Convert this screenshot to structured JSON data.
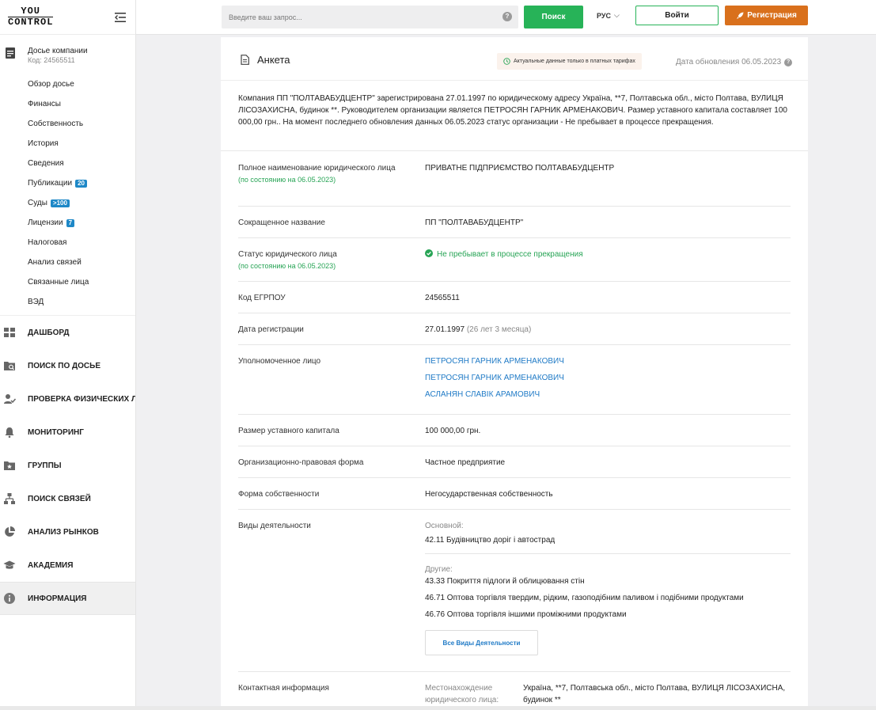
{
  "logo": {
    "line1": "YOU",
    "line2": "CONTROL"
  },
  "dossier": {
    "title": "Досье компании",
    "code": "Код: 24565511"
  },
  "sub_menu": [
    {
      "label": "Обзор досье"
    },
    {
      "label": "Финансы"
    },
    {
      "label": "Собственность"
    },
    {
      "label": "История"
    },
    {
      "label": "Сведения"
    },
    {
      "label": "Публикации",
      "badge": "20"
    },
    {
      "label": "Суды",
      "badge": ">100"
    },
    {
      "label": "Лицензии",
      "badge": "7"
    },
    {
      "label": "Налоговая"
    },
    {
      "label": "Анализ связей"
    },
    {
      "label": "Связанные лица"
    },
    {
      "label": "ВЭД"
    }
  ],
  "main_menu": [
    {
      "label": "ДАШБОРД",
      "icon": "dashboard-icon"
    },
    {
      "label": "ПОИСК ПО ДОСЬЕ",
      "icon": "folder-search-icon"
    },
    {
      "label": "ПРОВЕРКА ФИЗИЧЕСКИХ Л...",
      "icon": "person-check-icon"
    },
    {
      "label": "МОНИТОРИНГ",
      "icon": "bell-icon"
    },
    {
      "label": "ГРУППЫ",
      "icon": "folder-star-icon"
    },
    {
      "label": "ПОИСК СВЯЗЕЙ",
      "icon": "hierarchy-icon"
    },
    {
      "label": "АНАЛИЗ РЫНКОВ",
      "icon": "pie-chart-icon"
    },
    {
      "label": "АКАДЕМИЯ",
      "icon": "graduation-cap-icon"
    },
    {
      "label": "ИНФОРМАЦИЯ",
      "icon": "info-icon"
    }
  ],
  "header": {
    "search_placeholder": "Введите ваш запрос...",
    "search_button": "Поиск",
    "language": "РУС",
    "login": "Войти",
    "register": "Регистрация"
  },
  "card": {
    "title": "Анкета",
    "paid_note": "Актуальные данные только в платных тарифах",
    "update_date": "Дата обновления 06.05.2023",
    "summary": "Компания ПП \"ПОЛТАВАБУДЦЕНТР\" зарегистрирована 27.01.1997 по юридическому адресу Україна, **7, Полтавська обл., місто Полтава, ВУЛИЦЯ ЛІСОЗАХИСНА, будинок **. Руководителем организации является ПЕТРОСЯН ГАРНИК АРМЕНАКОВИЧ. Размер уставного капитала составляет 100 000,00 грн.. На момент последнего обновления данных 06.05.2023 статус организации - Не пребывает в процессе прекращения."
  },
  "rows": {
    "full_name": {
      "label": "Полное наименование юридического лица",
      "note": "(по состоянию на 06.05.2023)",
      "value": "ПРИВАТНЕ ПІДПРИЄМСТВО ПОЛТАВАБУДЦЕНТР"
    },
    "short_name": {
      "label": "Сокращенное название",
      "value": "ПП \"ПОЛТАВАБУДЦЕНТР\""
    },
    "status": {
      "label": "Статус юридического лица",
      "note": "(по состоянию на 06.05.2023)",
      "value": "Не пребывает в процессе прекращения"
    },
    "edrpou": {
      "label": "Код ЕГРПОУ",
      "value": "24565511"
    },
    "reg_date": {
      "label": "Дата регистрации",
      "value": "27.01.1997",
      "age": "(26 лет 3 месяца)"
    },
    "authorized": {
      "label": "Уполномоченное лицо",
      "persons": [
        "ПЕТРОСЯН ГАРНИК АРМЕНАКОВИЧ",
        "ПЕТРОСЯН ГАРНИК АРМЕНАКОВИЧ",
        "АСЛАНЯН СЛАВІК АРАМОВИЧ"
      ]
    },
    "capital": {
      "label": "Размер уставного капитала",
      "value": "100 000,00 грн."
    },
    "legal_form": {
      "label": "Организационно-правовая форма",
      "value": "Частное предприятие"
    },
    "ownership": {
      "label": "Форма собственности",
      "value": "Негосударственная собственность"
    },
    "activities": {
      "label": "Виды деятельности",
      "main_label": "Основной:",
      "main": "42.11 Будівництво доріг і автострад",
      "other_label": "Другие:",
      "other": [
        "43.33 Покриття підлоги й облицювання стін",
        "46.71 Оптова торгівля твердим, рідким, газоподібним паливом і подібними продуктами",
        "46.76 Оптова торгівля іншими проміжними продуктами"
      ],
      "all_button": "Все Виды Деятельности"
    },
    "contact": {
      "label": "Контактная информация",
      "location_key": "Местонахождение юридического лица:",
      "location": "Україна, **7, Полтавська обл., місто Полтава, ВУЛИЦЯ ЛІСОЗАХИСНА, будинок **"
    }
  },
  "colors": {
    "accent_green": "#27b358",
    "register_orange": "#d9701c",
    "link_blue": "#1f7ac6",
    "badge_blue": "#1e88c7"
  }
}
